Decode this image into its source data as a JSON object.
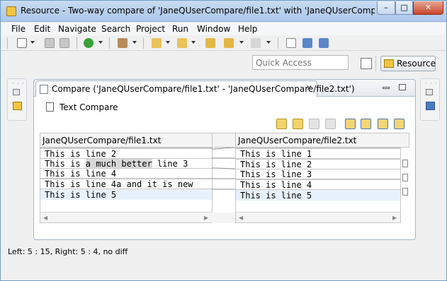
{
  "window": {
    "title": "Resource - Two-way compare of 'JaneQUserCompare/file1.txt' with 'JaneQUserCompare/fil...",
    "min_label": "–",
    "max_label": "□",
    "close_label": "✕"
  },
  "menu": [
    "File",
    "Edit",
    "Navigate",
    "Search",
    "Project",
    "Run",
    "Window",
    "Help"
  ],
  "quick_access": {
    "placeholder": "Quick Access"
  },
  "perspective": {
    "label": "Resource"
  },
  "editor": {
    "tab_label": "Compare ('JaneQUserCompare/file1.txt' - 'JaneQUserCompare/file2.txt')",
    "tab_close": "✕",
    "section_title": "Text Compare"
  },
  "left_pane": {
    "header": "JaneQUserCompare/file1.txt",
    "lines": [
      "This is line 2",
      "This is ",
      "a much better",
      " line 3",
      "This is line 4",
      "This is line 4a and it is new",
      "This is line 5"
    ]
  },
  "right_pane": {
    "header": "JaneQUserCompare/file2.txt",
    "lines": [
      "This is line 1",
      "This is line 2",
      "This is line 3",
      "This is line 4",
      "This is line 5"
    ]
  },
  "status": "Left: 5 : 15, Right: 5 : 4, no diff",
  "colors": {
    "accent": "#3399ff",
    "diff_border": "#c8c8c8",
    "current_line": "#e8f2fe"
  }
}
